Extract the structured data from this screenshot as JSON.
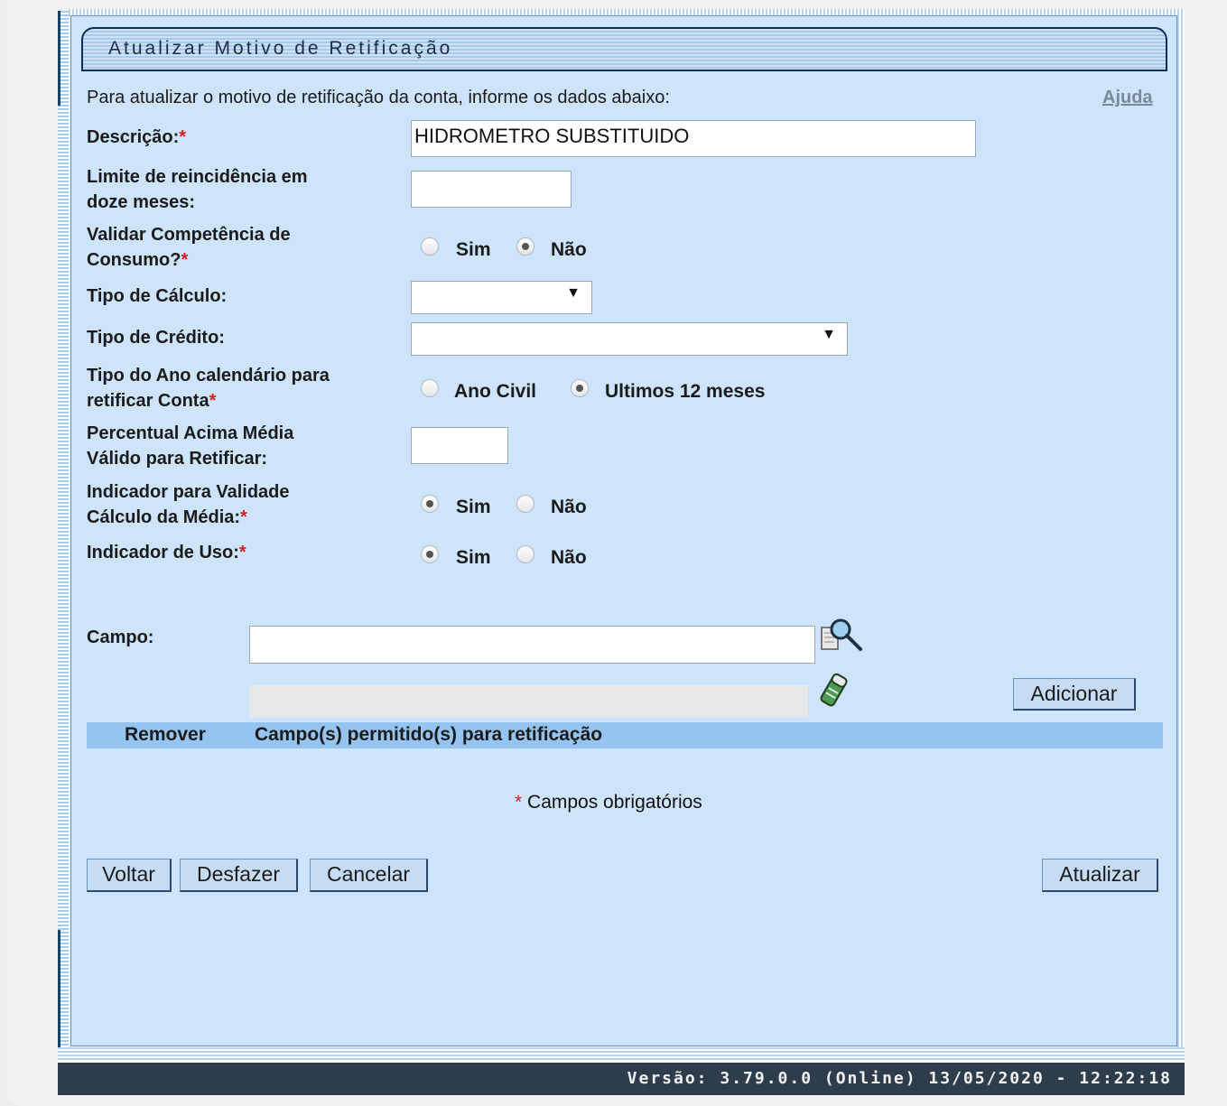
{
  "title": "Atualizar Motivo de Retificação",
  "intro": "Para atualizar o motivo de retificação da conta, informe os dados abaixo:",
  "help_link": "Ajuda",
  "required_mark": "*",
  "fields": {
    "descricao": {
      "label": "Descrição:",
      "value": "HIDROMETRO SUBSTITUIDO"
    },
    "limite": {
      "label_line1": "Limite de reincidência em",
      "label_line2": "doze meses:",
      "value": ""
    },
    "validar_competencia": {
      "label_line1": "Validar Competência de",
      "label_line2": "Consumo?",
      "option_sim": "Sim",
      "option_nao": "Não",
      "selected": "Não"
    },
    "tipo_calculo": {
      "label": "Tipo de Cálculo:",
      "value": ""
    },
    "tipo_credito": {
      "label": "Tipo de Crédito:",
      "value": ""
    },
    "tipo_ano": {
      "label_line1": "Tipo do Ano calendário para",
      "label_line2": "retificar Conta",
      "option_ano_civil": "Ano Civil",
      "option_ultimos": "Ultimos 12 meses",
      "selected": "Ultimos 12 meses"
    },
    "percentual": {
      "label_line1": "Percentual Acima Média",
      "label_line2": "Válido para Retificar:",
      "value": ""
    },
    "indicador_validade": {
      "label_line1": "Indicador para Validade",
      "label_line2": "Cálculo da Média:",
      "option_sim": "Sim",
      "option_nao": "Não",
      "selected": "Sim"
    },
    "indicador_uso": {
      "label": "Indicador de Uso:",
      "option_sim": "Sim",
      "option_nao": "Não",
      "selected": "Sim"
    },
    "campo": {
      "label": "Campo:",
      "value": "",
      "selected_value": ""
    }
  },
  "buttons": {
    "adicionar": "Adicionar",
    "voltar": "Voltar",
    "desfazer": "Desfazer",
    "cancelar": "Cancelar",
    "atualizar": "Atualizar"
  },
  "table": {
    "columns": [
      "Remover",
      "Campo(s) permitido(s) para retificação"
    ],
    "rows": []
  },
  "required_note": "Campos obrigatórios",
  "footer": "Versão: 3.79.0.0 (Online) 13/05/2020 - 12:22:18",
  "icons": {
    "search": "magnifier-document-icon",
    "clear": "eraser-icon",
    "select_arrow": "chevron-down-icon"
  },
  "colors": {
    "panel_bg": "#cde4fb",
    "header_row": "#96c4f0",
    "button_bg": "#c6dcf5",
    "footer_bg": "#2e3d4c",
    "required": "#d62020"
  }
}
